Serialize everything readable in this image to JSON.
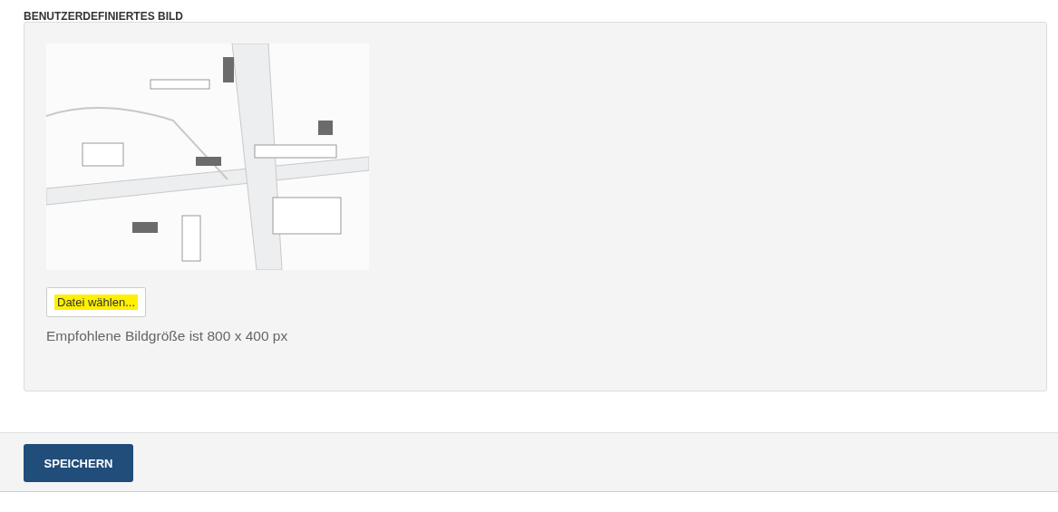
{
  "section": {
    "title": "BENUTZERDEFINIERTES BILD"
  },
  "file_button": {
    "label": "Datei wählen...",
    "highlighted": true
  },
  "hint": "Empfohlene Bildgröße ist 800 x 400 px",
  "footer": {
    "save_button": "SPEICHERN"
  }
}
